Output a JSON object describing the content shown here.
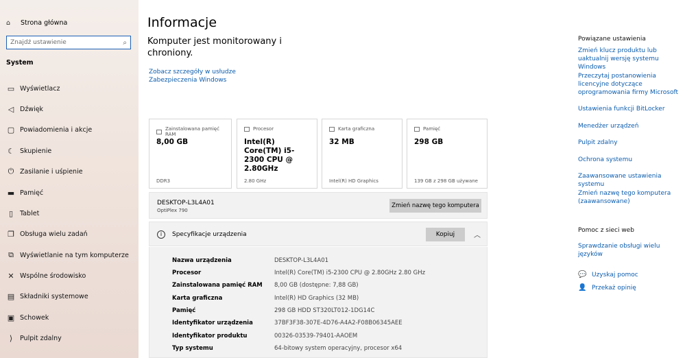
{
  "sidebar": {
    "home": "Strona główna",
    "search_placeholder": "Znajdź ustawienie",
    "section": "System",
    "items": [
      {
        "label": "Wyświetlacz",
        "icon": "monitor-icon"
      },
      {
        "label": "Dźwięk",
        "icon": "speaker-icon"
      },
      {
        "label": "Powiadomienia i akcje",
        "icon": "notification-icon"
      },
      {
        "label": "Skupienie",
        "icon": "moon-icon"
      },
      {
        "label": "Zasilanie i uśpienie",
        "icon": "power-icon"
      },
      {
        "label": "Pamięć",
        "icon": "storage-icon"
      },
      {
        "label": "Tablet",
        "icon": "tablet-icon"
      },
      {
        "label": "Obsługa wielu zadań",
        "icon": "multitask-icon"
      },
      {
        "label": "Wyświetlanie na tym komputerze",
        "icon": "project-icon"
      },
      {
        "label": "Wspólne środowisko",
        "icon": "shared-icon"
      },
      {
        "label": "Składniki systemowe",
        "icon": "components-icon"
      },
      {
        "label": "Schowek",
        "icon": "clipboard-icon"
      },
      {
        "label": "Pulpit zdalny",
        "icon": "remote-icon"
      }
    ]
  },
  "main": {
    "title": "Informacje",
    "status": "Komputer jest monitorowany i chroniony.",
    "details_link": "Zobacz szczegóły w usłudze Zabezpieczenia Windows",
    "cards": [
      {
        "label": "Zainstalowana pamięć RAM",
        "value": "8,00 GB",
        "sub": "DDR3"
      },
      {
        "label": "Procesor",
        "value": "Intel(R) Core(TM) i5-2300 CPU @ 2.80GHz",
        "sub": "2.80 GHz"
      },
      {
        "label": "Karta graficzna",
        "value": "32 MB",
        "sub": "Intel(R) HD Graphics"
      },
      {
        "label": "Pamięć",
        "value": "298 GB",
        "sub": "139 GB z 298 GB używane"
      }
    ],
    "device_name": "DESKTOP-L3L4A01",
    "device_model": "OptiPlex 790",
    "rename_label": "Zmień nazwę tego komputera",
    "spec_title": "Specyfikacje urządzenia",
    "copy_label": "Kopiuj",
    "specs": [
      {
        "k": "Nazwa urządzenia",
        "v": "DESKTOP-L3L4A01"
      },
      {
        "k": "Procesor",
        "v": "Intel(R) Core(TM) i5-2300 CPU @ 2.80GHz   2.80 GHz"
      },
      {
        "k": "Zainstalowana pamięć RAM",
        "v": "8,00 GB (dostępne: 7,88 GB)"
      },
      {
        "k": "Karta graficzna",
        "v": "Intel(R) HD Graphics (32 MB)"
      },
      {
        "k": "Pamięć",
        "v": "298 GB HDD ST320LT012-1DG14C"
      },
      {
        "k": "Identyfikator urządzenia",
        "v": "37BF3F38-307E-4D76-A4A2-F08B06345AEE"
      },
      {
        "k": "Identyfikator produktu",
        "v": "00326-03539-79401-AAOEM"
      },
      {
        "k": "Typ systemu",
        "v": "64-bitowy system operacyjny, procesor x64"
      }
    ]
  },
  "right": {
    "related_title": "Powiązane ustawienia",
    "related_links": [
      "Zmień klucz produktu lub uaktualnij wersję systemu Windows",
      "Przeczytaj postanowienia licencyjne dotyczące oprogramowania firmy Microsoft",
      "Ustawienia funkcji BitLocker",
      "Menedżer urządzeń",
      "Pulpit zdalny",
      "Ochrona systemu",
      "Zaawansowane ustawienia systemu",
      "Zmień nazwę tego komputera (zaawansowane)"
    ],
    "help_title": "Pomoc z sieci web",
    "help_link": "Sprawdzanie obsługi wielu języków",
    "get_help": "Uzyskaj pomoc",
    "feedback": "Przekaż opinię"
  }
}
